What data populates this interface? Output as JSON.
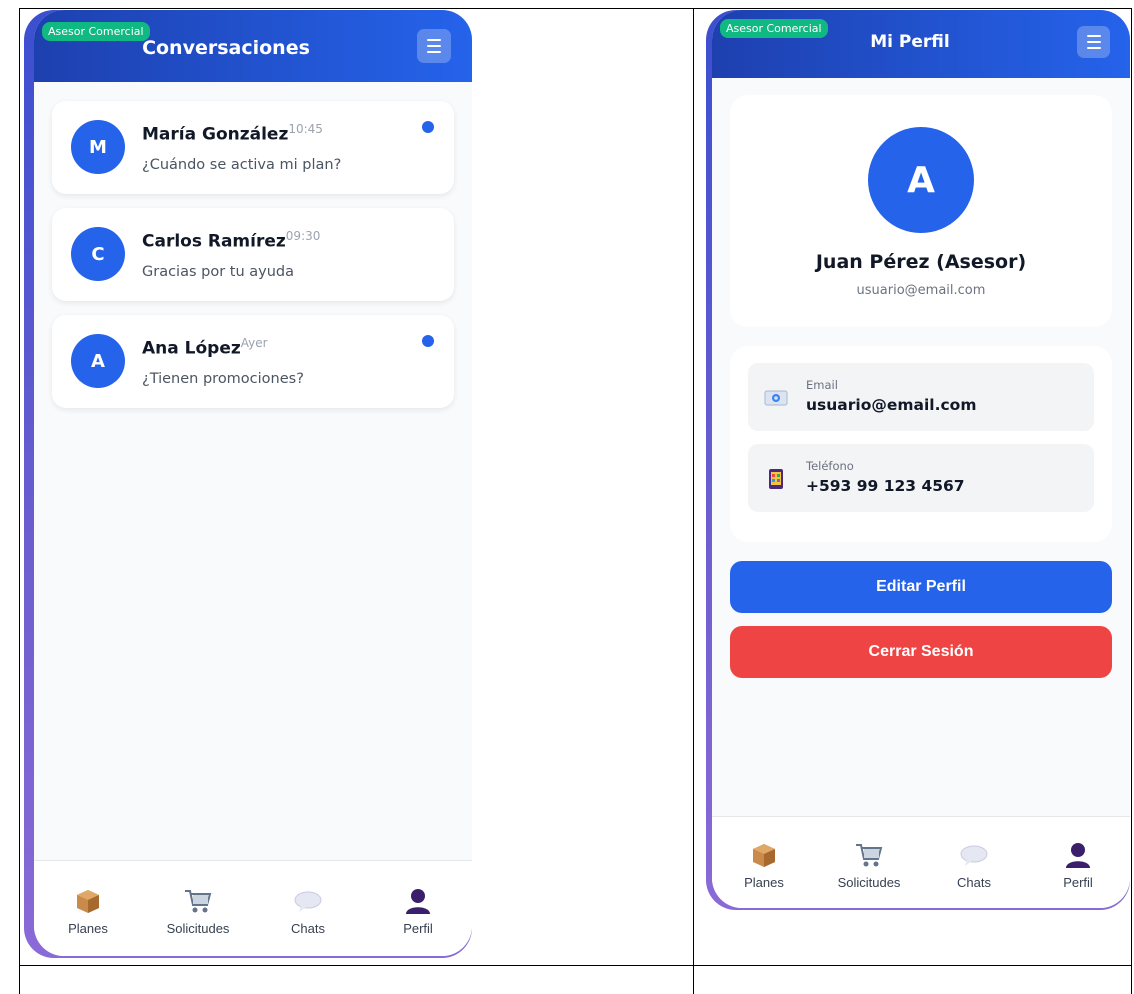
{
  "colors": {
    "header_blue": "#2563eb",
    "header_dark": "#1e40af",
    "badge_green": "#10b981",
    "logout_red": "#ef4444",
    "background": "#f8fafc"
  },
  "left_screen": {
    "role_badge": "Asesor Comercial",
    "title": "Conversaciones",
    "menu_icon": "hamburger-menu-icon",
    "chats": [
      {
        "initial": "M",
        "name": "María González",
        "time": "10:45",
        "message": "¿Cuándo se activa mi plan?",
        "unread": true
      },
      {
        "initial": "C",
        "name": "Carlos Ramírez",
        "time": "09:30",
        "message": "Gracias por tu ayuda",
        "unread": false
      },
      {
        "initial": "A",
        "name": "Ana López",
        "time": "Ayer",
        "message": "¿Tienen promociones?",
        "unread": true
      }
    ],
    "nav": [
      {
        "label": "Planes",
        "icon": "package-icon"
      },
      {
        "label": "Solicitudes",
        "icon": "cart-icon"
      },
      {
        "label": "Chats",
        "icon": "speech-bubble-icon"
      },
      {
        "label": "Perfil",
        "icon": "user-silhouette-icon"
      }
    ]
  },
  "right_screen": {
    "role_badge": "Asesor Comercial",
    "title": "Mi Perfil",
    "menu_icon": "hamburger-menu-icon",
    "profile": {
      "initial": "A",
      "name": "Juan Pérez (Asesor)",
      "email": "usuario@email.com"
    },
    "info": [
      {
        "label": "Email",
        "value": "usuario@email.com",
        "icon": "email-icon"
      },
      {
        "label": "Teléfono",
        "value": "+593 99 123 4567",
        "icon": "mobile-phone-icon"
      }
    ],
    "edit_button": "Editar Perfil",
    "logout_button": "Cerrar Sesión",
    "nav": [
      {
        "label": "Planes",
        "icon": "package-icon"
      },
      {
        "label": "Solicitudes",
        "icon": "cart-icon"
      },
      {
        "label": "Chats",
        "icon": "speech-bubble-icon"
      },
      {
        "label": "Perfil",
        "icon": "user-silhouette-icon"
      }
    ]
  }
}
